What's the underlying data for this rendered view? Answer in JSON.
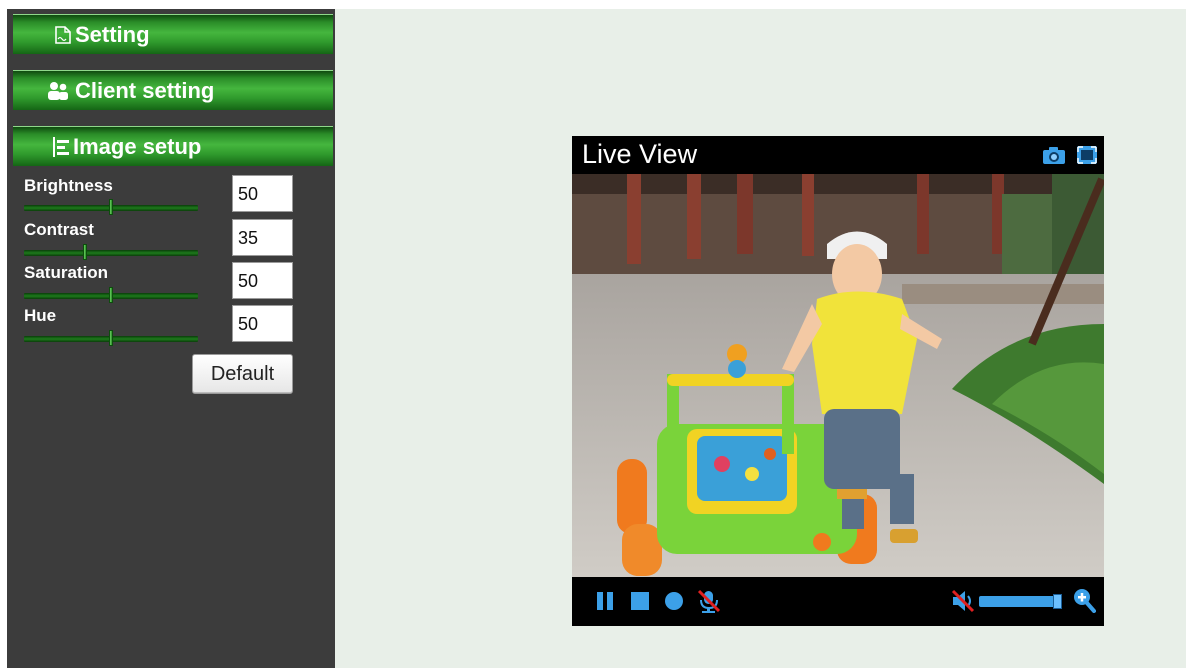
{
  "sidebar": {
    "menu": {
      "setting_label": "Setting",
      "client_label": "Client setting",
      "image_label": "Image setup"
    },
    "params": [
      {
        "label": "Brightness",
        "value": "50",
        "level": 0.5
      },
      {
        "label": "Contrast",
        "value": "35",
        "level": 0.35
      },
      {
        "label": "Saturation",
        "value": "50",
        "level": 0.5
      },
      {
        "label": "Hue",
        "value": "50",
        "level": 0.5
      }
    ],
    "default_label": "Default"
  },
  "viewer": {
    "title": "Live View",
    "icons": {
      "snapshot": "camera-icon",
      "fullscreen": "fullscreen-icon",
      "pause": "pause-icon",
      "stop": "stop-icon",
      "record": "record-icon",
      "mic": "microphone-muted-icon",
      "speaker": "speaker-muted-icon",
      "zoom": "zoom-in-icon"
    },
    "volume_level": 1.0
  },
  "colors": {
    "menu_green": "#2f9a2c",
    "sidebar_bg": "#3c3c3c",
    "main_bg": "#e8efe8",
    "viewer_bg": "#000000",
    "accent_blue": "#3ca0e8"
  }
}
